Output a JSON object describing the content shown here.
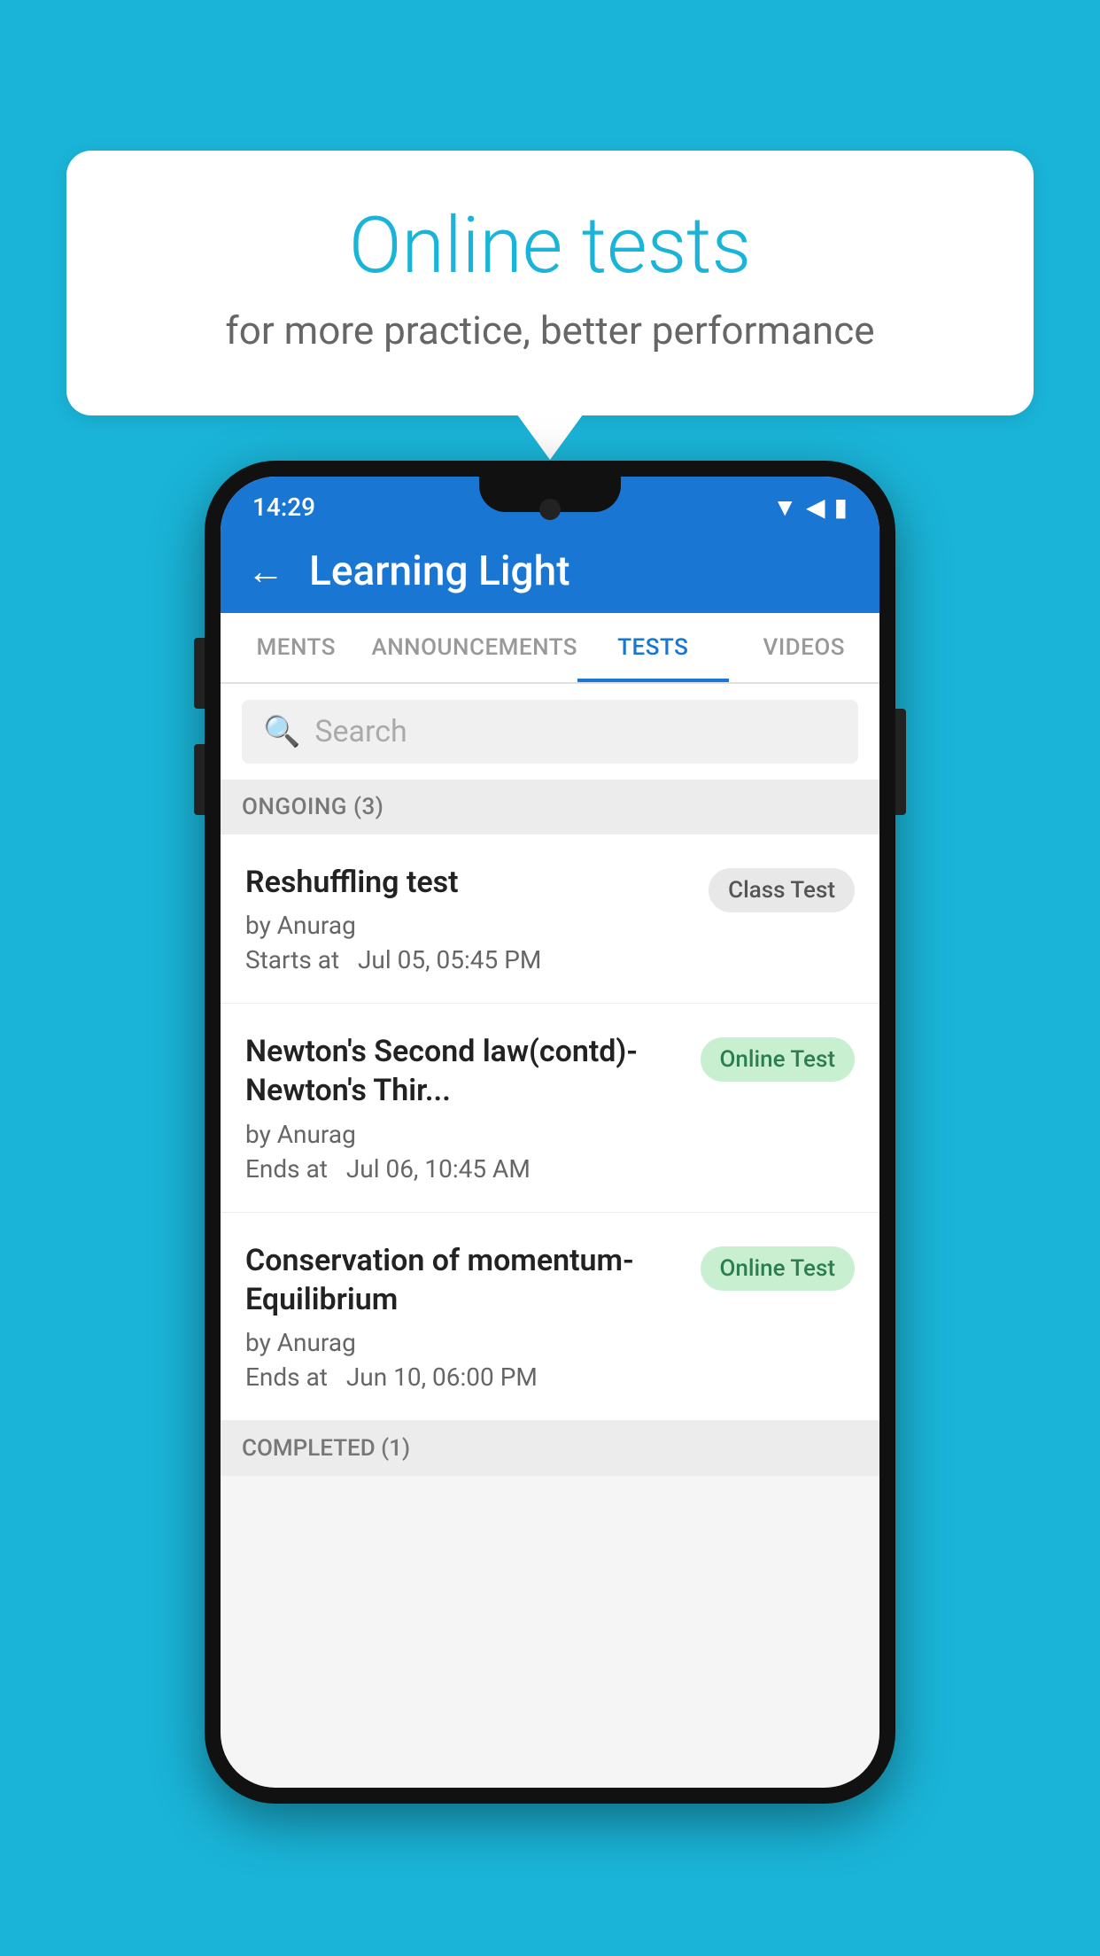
{
  "background": {
    "color": "#1ab4d8"
  },
  "speech_bubble": {
    "title": "Online tests",
    "subtitle": "for more practice, better performance"
  },
  "phone": {
    "status_bar": {
      "time": "14:29",
      "icons": [
        "wifi",
        "signal",
        "battery"
      ]
    },
    "header": {
      "back_label": "←",
      "title": "Learning Light"
    },
    "tabs": [
      {
        "label": "MENTS",
        "active": false
      },
      {
        "label": "ANNOUNCEMENTS",
        "active": false
      },
      {
        "label": "TESTS",
        "active": true
      },
      {
        "label": "VIDEOS",
        "active": false
      }
    ],
    "search": {
      "placeholder": "Search"
    },
    "ongoing_section": {
      "title": "ONGOING (3)"
    },
    "tests": [
      {
        "name": "Reshuffling test",
        "author": "by Anurag",
        "time_label": "Starts at",
        "time": "Jul 05, 05:45 PM",
        "badge": "Class Test",
        "badge_type": "class"
      },
      {
        "name": "Newton's Second law(contd)-Newton's Thir...",
        "author": "by Anurag",
        "time_label": "Ends at",
        "time": "Jul 06, 10:45 AM",
        "badge": "Online Test",
        "badge_type": "online"
      },
      {
        "name": "Conservation of momentum-Equilibrium",
        "author": "by Anurag",
        "time_label": "Ends at",
        "time": "Jun 10, 06:00 PM",
        "badge": "Online Test",
        "badge_type": "online"
      }
    ],
    "completed_section": {
      "title": "COMPLETED (1)"
    }
  }
}
